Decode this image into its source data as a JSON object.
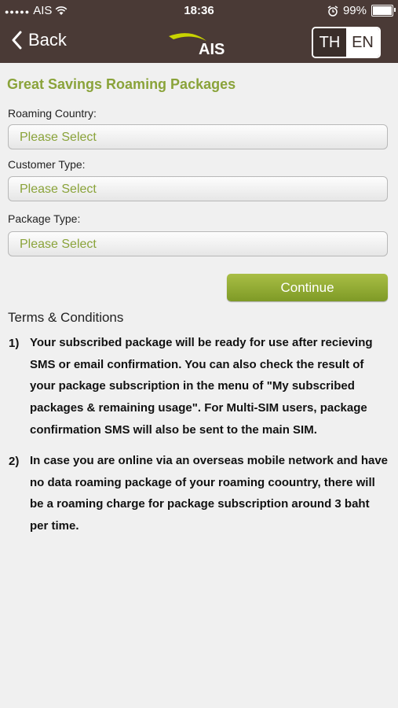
{
  "status": {
    "carrier": "AIS",
    "time": "18:36",
    "battery": "99%",
    "battery_level": 0.99
  },
  "nav": {
    "back_label": "Back",
    "logo_text": "AIS",
    "lang_th": "TH",
    "lang_en": "EN",
    "active_lang": "TH"
  },
  "form": {
    "title": "Great Savings Roaming Packages",
    "fields": [
      {
        "label": "Roaming Country:",
        "value": "Please Select"
      },
      {
        "label": "Customer Type:",
        "value": "Please Select"
      },
      {
        "label": "Package Type:",
        "value": "Please Select"
      }
    ],
    "continue_label": "Continue"
  },
  "terms": {
    "title": "Terms & Conditions",
    "items": [
      {
        "num": "1)",
        "text": "Your subscribed package will be ready for use after recieving SMS or email confirmation. You can also check the result of your package subscription in the menu of \"My subscribed packages & remaining usage\". For Multi-SIM users, package confirmation SMS will also be sent to the main SIM."
      },
      {
        "num": "2)",
        "text": "In case you are online via an overseas mobile network and have no data roaming package of your roaming coountry, there will be a roaming charge for package subscription around 3 baht per time."
      }
    ]
  },
  "colors": {
    "header_bg": "#4a3a36",
    "accent_green": "#8aa33a",
    "logo_yellow": "#c8d400"
  }
}
